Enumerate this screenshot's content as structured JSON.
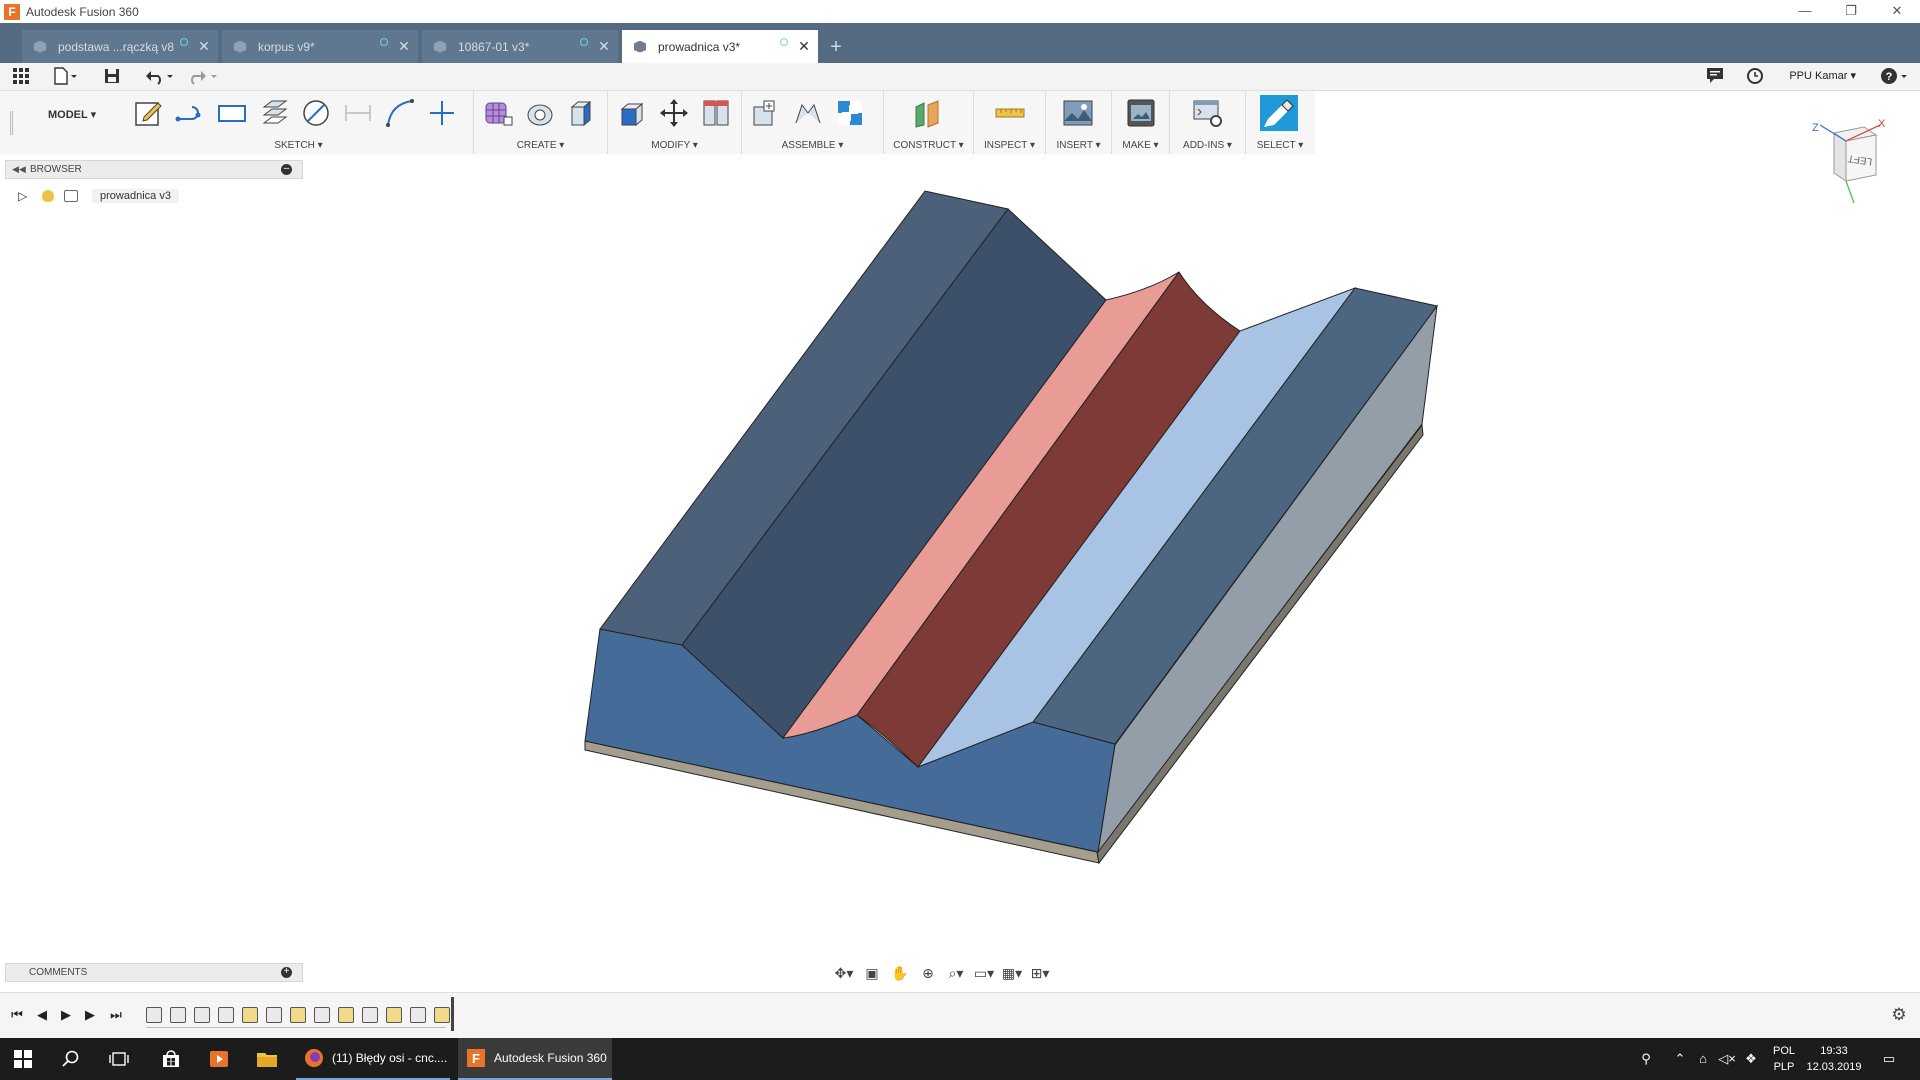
{
  "window": {
    "title": "Autodesk Fusion 360",
    "min": "—",
    "restore": "❐",
    "close": "✕"
  },
  "tabs": [
    {
      "label": "podstawa ...rączką v8",
      "close": "✕"
    },
    {
      "label": "korpus v9*",
      "close": "✕"
    },
    {
      "label": "10867-01 v3*",
      "close": "✕"
    },
    {
      "label": "prowadnica v3*",
      "close": "✕"
    }
  ],
  "tab_add": "+",
  "quickaccess": {
    "user": "PPU Kamar ▾",
    "help": "?"
  },
  "toolbar": {
    "workspace": "MODEL ▾",
    "groups": [
      "SKETCH ▾",
      "CREATE ▾",
      "MODIFY ▾",
      "ASSEMBLE ▾",
      "CONSTRUCT ▾",
      "INSPECT ▾",
      "INSERT ▾",
      "MAKE ▾",
      "ADD-INS ▾",
      "SELECT ▾"
    ]
  },
  "browser": {
    "title": "BROWSER",
    "item": "prowadnica v3"
  },
  "comments": {
    "title": "COMMENTS"
  },
  "viewcube": {
    "face": "LEFT",
    "axis_z": "Z",
    "axis_x": "X"
  },
  "taskbar": {
    "apps": [
      {
        "label": "(11) Błędy osi - cnc...."
      },
      {
        "label": "Autodesk Fusion 360"
      }
    ],
    "lang_top": "POL",
    "lang_bottom": "PLP",
    "time": "19:33",
    "date": "12.03.2019"
  },
  "colors": {
    "tabbar": "#546b82",
    "model_top_dark": "#4e6079",
    "model_groove_red": "#7e3a36",
    "model_groove_pink": "#e99b96",
    "model_light_face": "#a9c3e4",
    "model_front": "#456b99",
    "model_side": "#939ea8",
    "select_accent": "#1f9ad6"
  }
}
